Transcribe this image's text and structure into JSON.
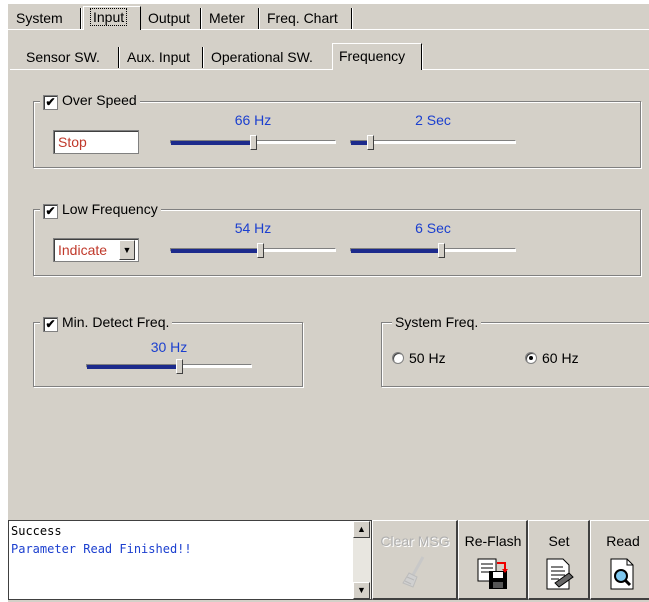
{
  "main_tabs": [
    "System",
    "Input",
    "Output",
    "Meter",
    "Freq. Chart"
  ],
  "main_tab_selected": "Input",
  "sub_tabs": [
    "Sensor SW.",
    "Aux. Input",
    "Operational SW.",
    "Frequency"
  ],
  "sub_tab_selected": "Frequency",
  "over_speed": {
    "label": "Over Speed",
    "checked": true,
    "check_mark": "✔",
    "action": "Stop",
    "freq_value": "66 Hz",
    "freq_level": 0.5,
    "delay_value": "2 Sec",
    "delay_level": 0.12
  },
  "low_frequency": {
    "label": "Low Frequency",
    "checked": true,
    "check_mark": "✔",
    "action": "Indicate",
    "dropdown_arrow": "▼",
    "freq_value": "54 Hz",
    "freq_level": 0.54,
    "delay_value": "6 Sec",
    "delay_level": 0.55
  },
  "min_detect": {
    "label": "Min. Detect Freq.",
    "checked": true,
    "check_mark": "✔",
    "value": "30 Hz",
    "level": 0.56
  },
  "system_freq": {
    "label": "System Freq.",
    "options": [
      "50 Hz",
      "60 Hz"
    ],
    "selected": "60 Hz"
  },
  "messages": {
    "line1": "Success",
    "line2": "Parameter Read Finished!!",
    "scroll_up": "▲",
    "scroll_down": "▼"
  },
  "buttons": {
    "clear_msg": "Clear MSG",
    "re_flash": "Re-Flash",
    "set": "Set",
    "read": "Read"
  },
  "colors": {
    "panel": "#d4d0c8",
    "value_text": "#1b3fcf",
    "action_text": "#c0392b",
    "slider_fill": "#1c2a8c"
  }
}
